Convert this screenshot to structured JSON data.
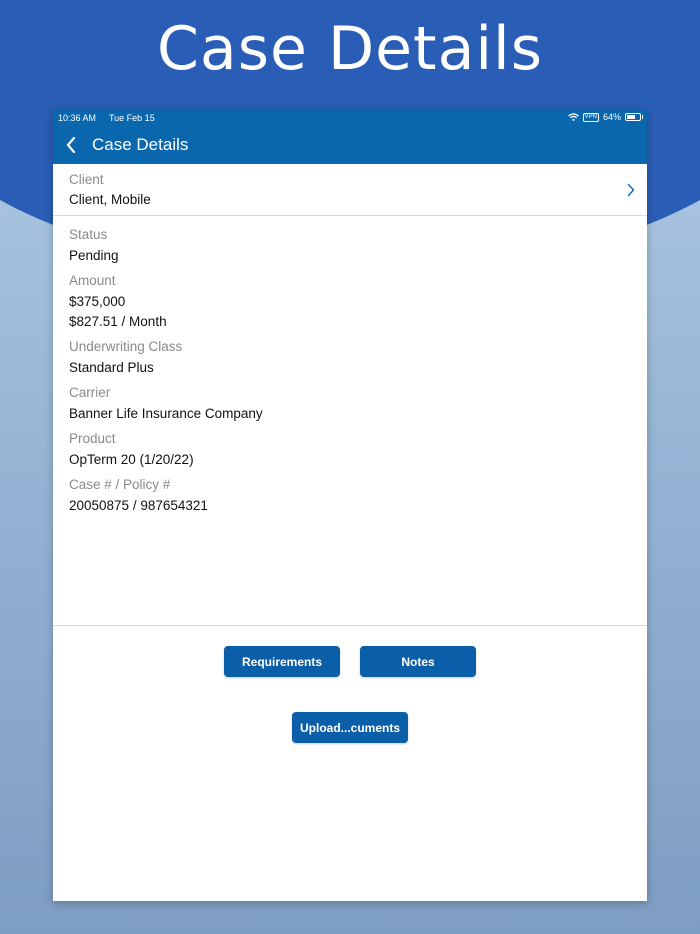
{
  "promo": {
    "title": "Case Details"
  },
  "status_bar": {
    "time": "10:36 AM",
    "date": "Tue Feb 15",
    "vpn": "VPN",
    "battery": "64%",
    "battery_level": 0.64
  },
  "navbar": {
    "title": "Case Details"
  },
  "client": {
    "label": "Client",
    "value": "Client, Mobile"
  },
  "fields": {
    "status": {
      "label": "Status",
      "value": "Pending"
    },
    "amount": {
      "label": "Amount",
      "value": "$375,000",
      "value2": "$827.51 / Month"
    },
    "underwriting": {
      "label": "Underwriting Class",
      "value": "Standard Plus"
    },
    "carrier": {
      "label": "Carrier",
      "value": "Banner Life Insurance Company"
    },
    "product": {
      "label": "Product",
      "value": "OpTerm 20 (1/20/22)"
    },
    "case_policy": {
      "label": "Case # / Policy #",
      "value": "20050875 / 987654321"
    }
  },
  "buttons": {
    "requirements": "Requirements",
    "notes": "Notes",
    "upload": "Upload...cuments"
  },
  "colors": {
    "brand_blue": "#2a5db5",
    "navbar": "#0a67ad",
    "button": "#0b5fa8",
    "chevron": "#1a73c2"
  }
}
